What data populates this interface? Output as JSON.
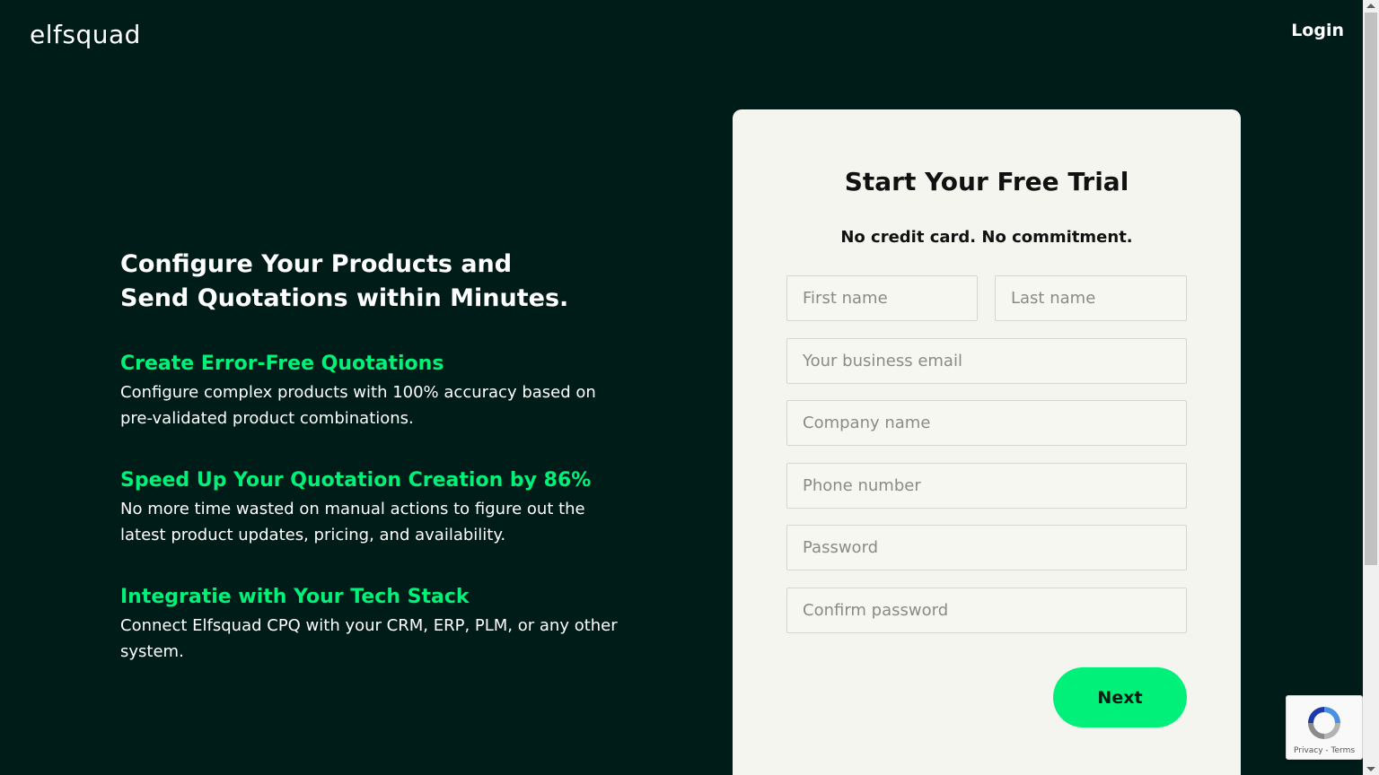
{
  "header": {
    "logo": "elfsquad",
    "login_label": "Login"
  },
  "hero": {
    "headline": "Configure Your Products and Send Quotations within Minutes.",
    "features": [
      {
        "title": "Create Error-Free Quotations",
        "text": "Configure complex products with 100% accuracy based on pre-validated product combinations."
      },
      {
        "title": "Speed Up Your Quotation Creation by 86%",
        "text": "No more time wasted on manual actions to figure out the latest product updates, pricing, and availability."
      },
      {
        "title": "Integratie with Your Tech Stack",
        "text": "Connect Elfsquad CPQ with your CRM, ERP, PLM, or any other system."
      }
    ]
  },
  "form": {
    "title": "Start Your Free Trial",
    "subtitle": "No credit card. No commitment.",
    "first_name_placeholder": "First name",
    "last_name_placeholder": "Last name",
    "email_placeholder": "Your business email",
    "company_placeholder": "Company name",
    "phone_placeholder": "Phone number",
    "password_placeholder": "Password",
    "confirm_password_placeholder": "Confirm password",
    "next_label": "Next"
  },
  "recaptcha": {
    "icon": "recaptcha-icon",
    "links": "Privacy - Terms"
  },
  "colors": {
    "background": "#001c18",
    "accent": "#00f07a",
    "card": "#f5f5f0"
  }
}
